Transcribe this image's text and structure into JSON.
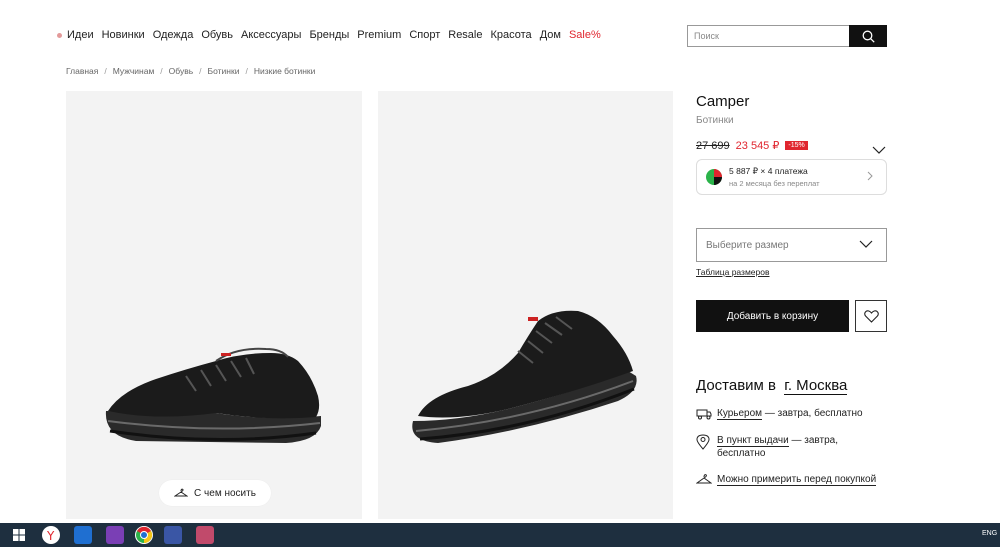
{
  "nav": {
    "items": [
      "Идеи",
      "Новинки",
      "Одежда",
      "Обувь",
      "Аксессуары",
      "Бренды",
      "Premium",
      "Спорт",
      "Resale",
      "Красота",
      "Дом"
    ],
    "sale": "Sale%"
  },
  "search": {
    "placeholder": "Поиск"
  },
  "breadcrumb": [
    "Главная",
    "Мужчинам",
    "Обувь",
    "Ботинки",
    "Низкие ботинки"
  ],
  "gallery": {
    "wear_label": "С чем носить"
  },
  "product": {
    "brand": "Camper",
    "category": "Ботинки",
    "old_price": "27 699",
    "new_price": "23 545 ₽",
    "discount": "-15%"
  },
  "installments": {
    "main": "5 887 ₽ × 4 платежа",
    "sub": "на 2 месяца без переплат"
  },
  "size": {
    "placeholder": "Выберите размер",
    "table_link": "Таблица размеров"
  },
  "actions": {
    "add_to_cart": "Добавить в корзину"
  },
  "delivery": {
    "title": "Доставим в",
    "city": "г. Москва",
    "courier_link": "Курьером",
    "courier_rest": " — завтра, бесплатно",
    "pickup_link": "В пункт выдачи",
    "pickup_rest": " — завтра, бесплатно",
    "fitting_link": "Можно примерить перед покупкой"
  },
  "taskbar": {
    "lang": "ENG"
  },
  "colors": {
    "accent": "#e0262f",
    "dark": "#111111",
    "photo_bg": "#f3f3f3",
    "taskbar": "#1e2f3f"
  },
  "icons": [
    "search-icon",
    "hanger-icon",
    "chevron-down-icon",
    "chevron-right-icon",
    "heart-icon",
    "truck-icon",
    "map-pin-icon"
  ]
}
